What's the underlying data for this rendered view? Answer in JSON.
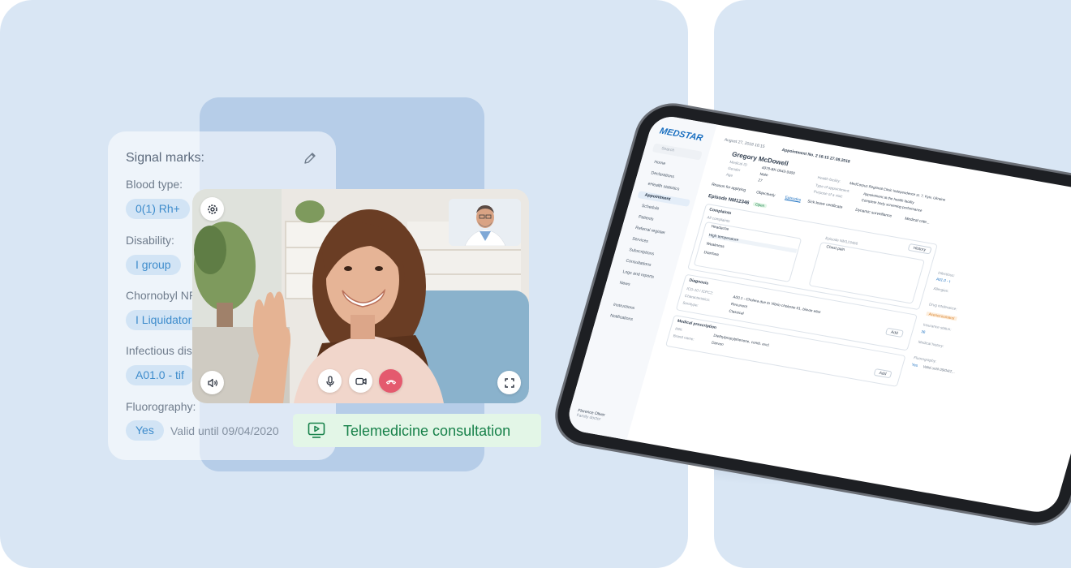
{
  "signal_card": {
    "title": "Signal marks:",
    "fields": [
      {
        "label": "Blood type:",
        "value": "0(1) Rh+"
      },
      {
        "label": "Disability:",
        "value": "I group"
      },
      {
        "label": "Chornobyl NPP:",
        "value": "I Liquidator"
      },
      {
        "label": "Infectious disease:",
        "value": "A01.0 - tif"
      },
      {
        "label": "Fluorography:",
        "value": "Yes",
        "extra": "Valid until 09/04/2020"
      }
    ]
  },
  "video_call": {
    "icons": [
      "gear-icon",
      "speaker-icon",
      "microphone-icon",
      "camera-icon",
      "end-call-icon",
      "fullscreen-icon"
    ]
  },
  "telemedicine": {
    "label": "Telemedicine consultation"
  },
  "tablet": {
    "logo": "MEDSTAR",
    "search_placeholder": "Search",
    "sidebar": [
      "Home",
      "Declarations",
      "eHealth statistics",
      "Appointment",
      "Schedule",
      "Patients",
      "Referral register",
      "Services",
      "Subscriptions",
      "Consultations",
      "Logs and reports",
      "News",
      "Instructions",
      "Notifications"
    ],
    "doctor": {
      "name": "Florence Oliver",
      "role": "Family doctor"
    },
    "breadcrumb": {
      "date": "August 27, 2018 16:15",
      "current": "Appointment No. 2 16:15 27.08.2018"
    },
    "patient": {
      "name": "Gregory McDowell",
      "medical_id_label": "Medical ID",
      "medical_id": "4978-BK-0643-9300",
      "gender_label": "Gender",
      "gender": "Male",
      "age_label": "Age",
      "age": "27",
      "facility_label": "Health facility:",
      "facility": "MedCorpus Regional Clinic Independence st. 7, Kyiv, Ukraine",
      "type_label": "Type of appointment:",
      "type": "Appointment at the health facility",
      "purpose_label": "Purpose of a visit:",
      "purpose": "Complete body screening performance"
    },
    "tabs": [
      "Reason for applying",
      "Objectively",
      "Episodes",
      "Sick leave certificate",
      "Dynamic surveillance",
      "Medical crite..."
    ],
    "episode": {
      "title": "Episode NM12346",
      "status": "Open",
      "history_btn": "History"
    },
    "complaints": {
      "title": "Complaints",
      "all_label": "All complaints",
      "items": [
        "Headache",
        "High temperature",
        "Weakness",
        "Diarrhea"
      ],
      "episode_label": "Episode NM123456",
      "episode_item": "Chest pain"
    },
    "diagnosis": {
      "title": "Diagnosis",
      "code_label": "ICD-10 / ICPC2:",
      "code": "A00.1 - Cholera due to Vibrio cholerae 01, biovar eltor",
      "char_label": "Characteristics:",
      "char": "Recurrent",
      "type_label": "Serotype:",
      "type": "Classical",
      "add": "Add"
    },
    "prescription": {
      "title": "Medical prescription",
      "inn_label": "INN:",
      "inn": "Diethylpropylphenone, comb. excl.",
      "brand_label": "Brand name:",
      "brand": "Darvon",
      "add": "Add"
    },
    "right_col": {
      "infection_label": "Infectious:",
      "infection": "A01.0 - t",
      "allergies_label": "Allergies:",
      "drug_label": "Drug intolerance:",
      "drug": "Acenocoumarol",
      "insurance_label": "Insurance status:",
      "insurance": "36",
      "history_label": "Medical history:",
      "fluoro_label": "Fluorography:",
      "fluoro_yes": "Yes",
      "fluoro_valid": "Valid until 09/04/2..."
    }
  }
}
